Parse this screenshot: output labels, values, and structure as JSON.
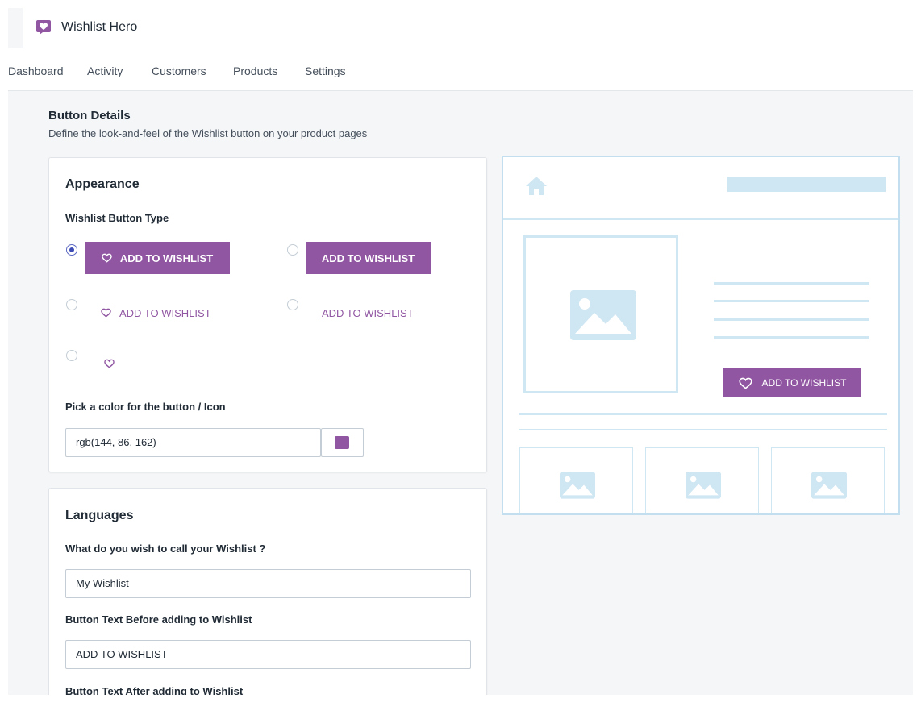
{
  "app": {
    "title": "Wishlist Hero",
    "brand_color": "#9056a2"
  },
  "nav": {
    "items": [
      {
        "label": "Dashboard"
      },
      {
        "label": "Activity"
      },
      {
        "label": "Customers"
      },
      {
        "label": "Products"
      },
      {
        "label": "Settings"
      }
    ]
  },
  "section": {
    "title": "Button Details",
    "description": "Define the look-and-feel of the Wishlist button on your product pages"
  },
  "appearance": {
    "title": "Appearance",
    "type_label": "Wishlist Button Type",
    "button_text": "ADD TO WISHLIST",
    "options": [
      {
        "style": "filled-with-icon",
        "selected": true
      },
      {
        "style": "filled-text-only",
        "selected": false
      },
      {
        "style": "text-with-icon",
        "selected": false
      },
      {
        "style": "text-only",
        "selected": false
      },
      {
        "style": "icon-only",
        "selected": false
      }
    ],
    "color_label": "Pick a color for the button / Icon",
    "color_value": "rgb(144, 86, 162)",
    "color_hex": "#9056a2"
  },
  "languages": {
    "title": "Languages",
    "wishlist_name_label": "What do you wish to call your Wishlist ?",
    "wishlist_name_value": "My Wishlist",
    "before_label": "Button Text Before adding to Wishlist",
    "before_value": "ADD TO WISHLIST",
    "after_label": "Button Text After adding to Wishlist"
  },
  "preview": {
    "button_text": "ADD TO WISHLIST",
    "wireframe_color": "#cfe6f3"
  }
}
